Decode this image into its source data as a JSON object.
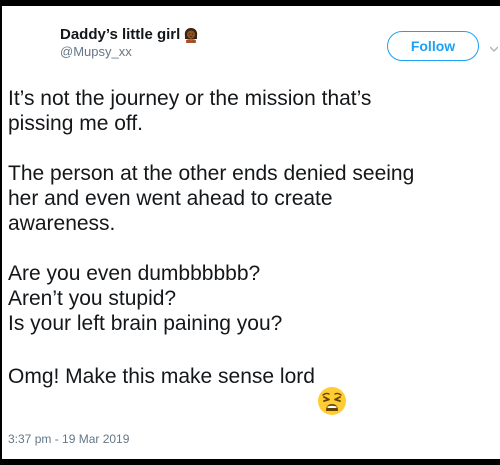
{
  "header": {
    "display_name": "Daddy’s little girl",
    "handle": "@Mupsy_xx",
    "follow_label": "Follow"
  },
  "tweet": {
    "paragraph_1": "It’s not the journey or the mission that’s\npissing me off.",
    "paragraph_2": "The person at the other ends denied seeing\nher and even went ahead to create\nawareness.",
    "paragraph_3": "Are you even dumbbbbbb?\nAren’t you stupid?\nIs your left brain paining you?",
    "paragraph_4": "Omg! Make this make sense lord",
    "timestamp": "3:37 pm - 19 Mar 2019"
  },
  "icons": {
    "name_emoji": "woman-gesturing-no-emoji",
    "end_emoji": "weary-face-emoji",
    "menu": "chevron-down-icon"
  },
  "colors": {
    "accent": "#1da1f2",
    "text": "#14171a",
    "secondary": "#657786"
  }
}
